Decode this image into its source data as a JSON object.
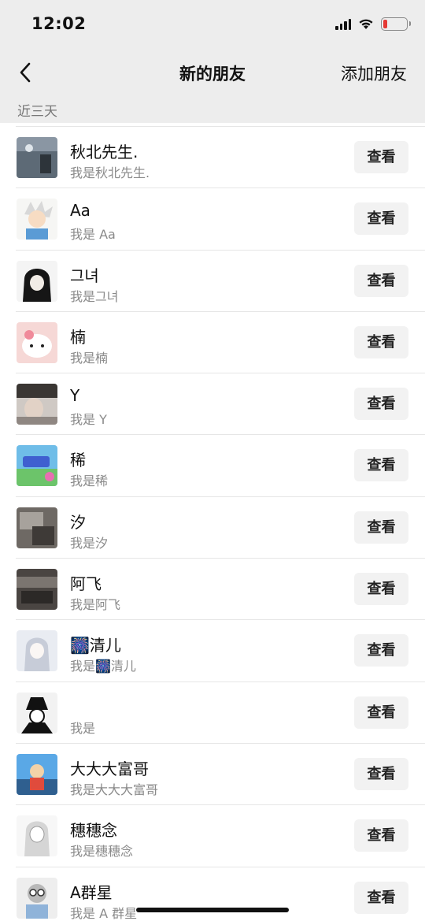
{
  "status_bar": {
    "time": "12:02"
  },
  "nav": {
    "back_icon": "chevron-left-icon",
    "title": "新的朋友",
    "action": "添加朋友"
  },
  "section": {
    "label": "近三天"
  },
  "requests": [
    {
      "name": "秋北先生.",
      "message": "我是秋北先生.",
      "button": "查看",
      "avatar": "photo-avatar"
    },
    {
      "name": "Aa",
      "message": "我是 Aa",
      "button": "查看",
      "avatar": "cartoon-avatar"
    },
    {
      "name": "그녀",
      "message": "我是그녀",
      "button": "查看",
      "avatar": "anime-avatar"
    },
    {
      "name": "楠",
      "message": "我是楠",
      "button": "查看",
      "avatar": "kitty-avatar"
    },
    {
      "name": "Y",
      "message": "我是 Y",
      "button": "查看",
      "avatar": "photo-avatar"
    },
    {
      "name": "稀",
      "message": "我是稀",
      "button": "查看",
      "avatar": "illustration-avatar"
    },
    {
      "name": "汐",
      "message": "我是汐",
      "button": "查看",
      "avatar": "photo-avatar"
    },
    {
      "name": "阿飞",
      "message": "我是阿飞",
      "button": "查看",
      "avatar": "photo-avatar"
    },
    {
      "name": "🎆清儿",
      "message": "我是🎆清儿",
      "button": "查看",
      "avatar": "anime-avatar"
    },
    {
      "name": "",
      "message": "我是",
      "button": "查看",
      "avatar": "anime-avatar"
    },
    {
      "name": "大大大富哥",
      "message": "我是大大大富哥",
      "button": "查看",
      "avatar": "cartoon-avatar"
    },
    {
      "name": "穗穗念",
      "message": "我是穗穗念",
      "button": "查看",
      "avatar": "anime-avatar"
    },
    {
      "name": "A群星",
      "message": "我是 A 群星",
      "button": "查看",
      "avatar": "cartoon-avatar"
    }
  ]
}
